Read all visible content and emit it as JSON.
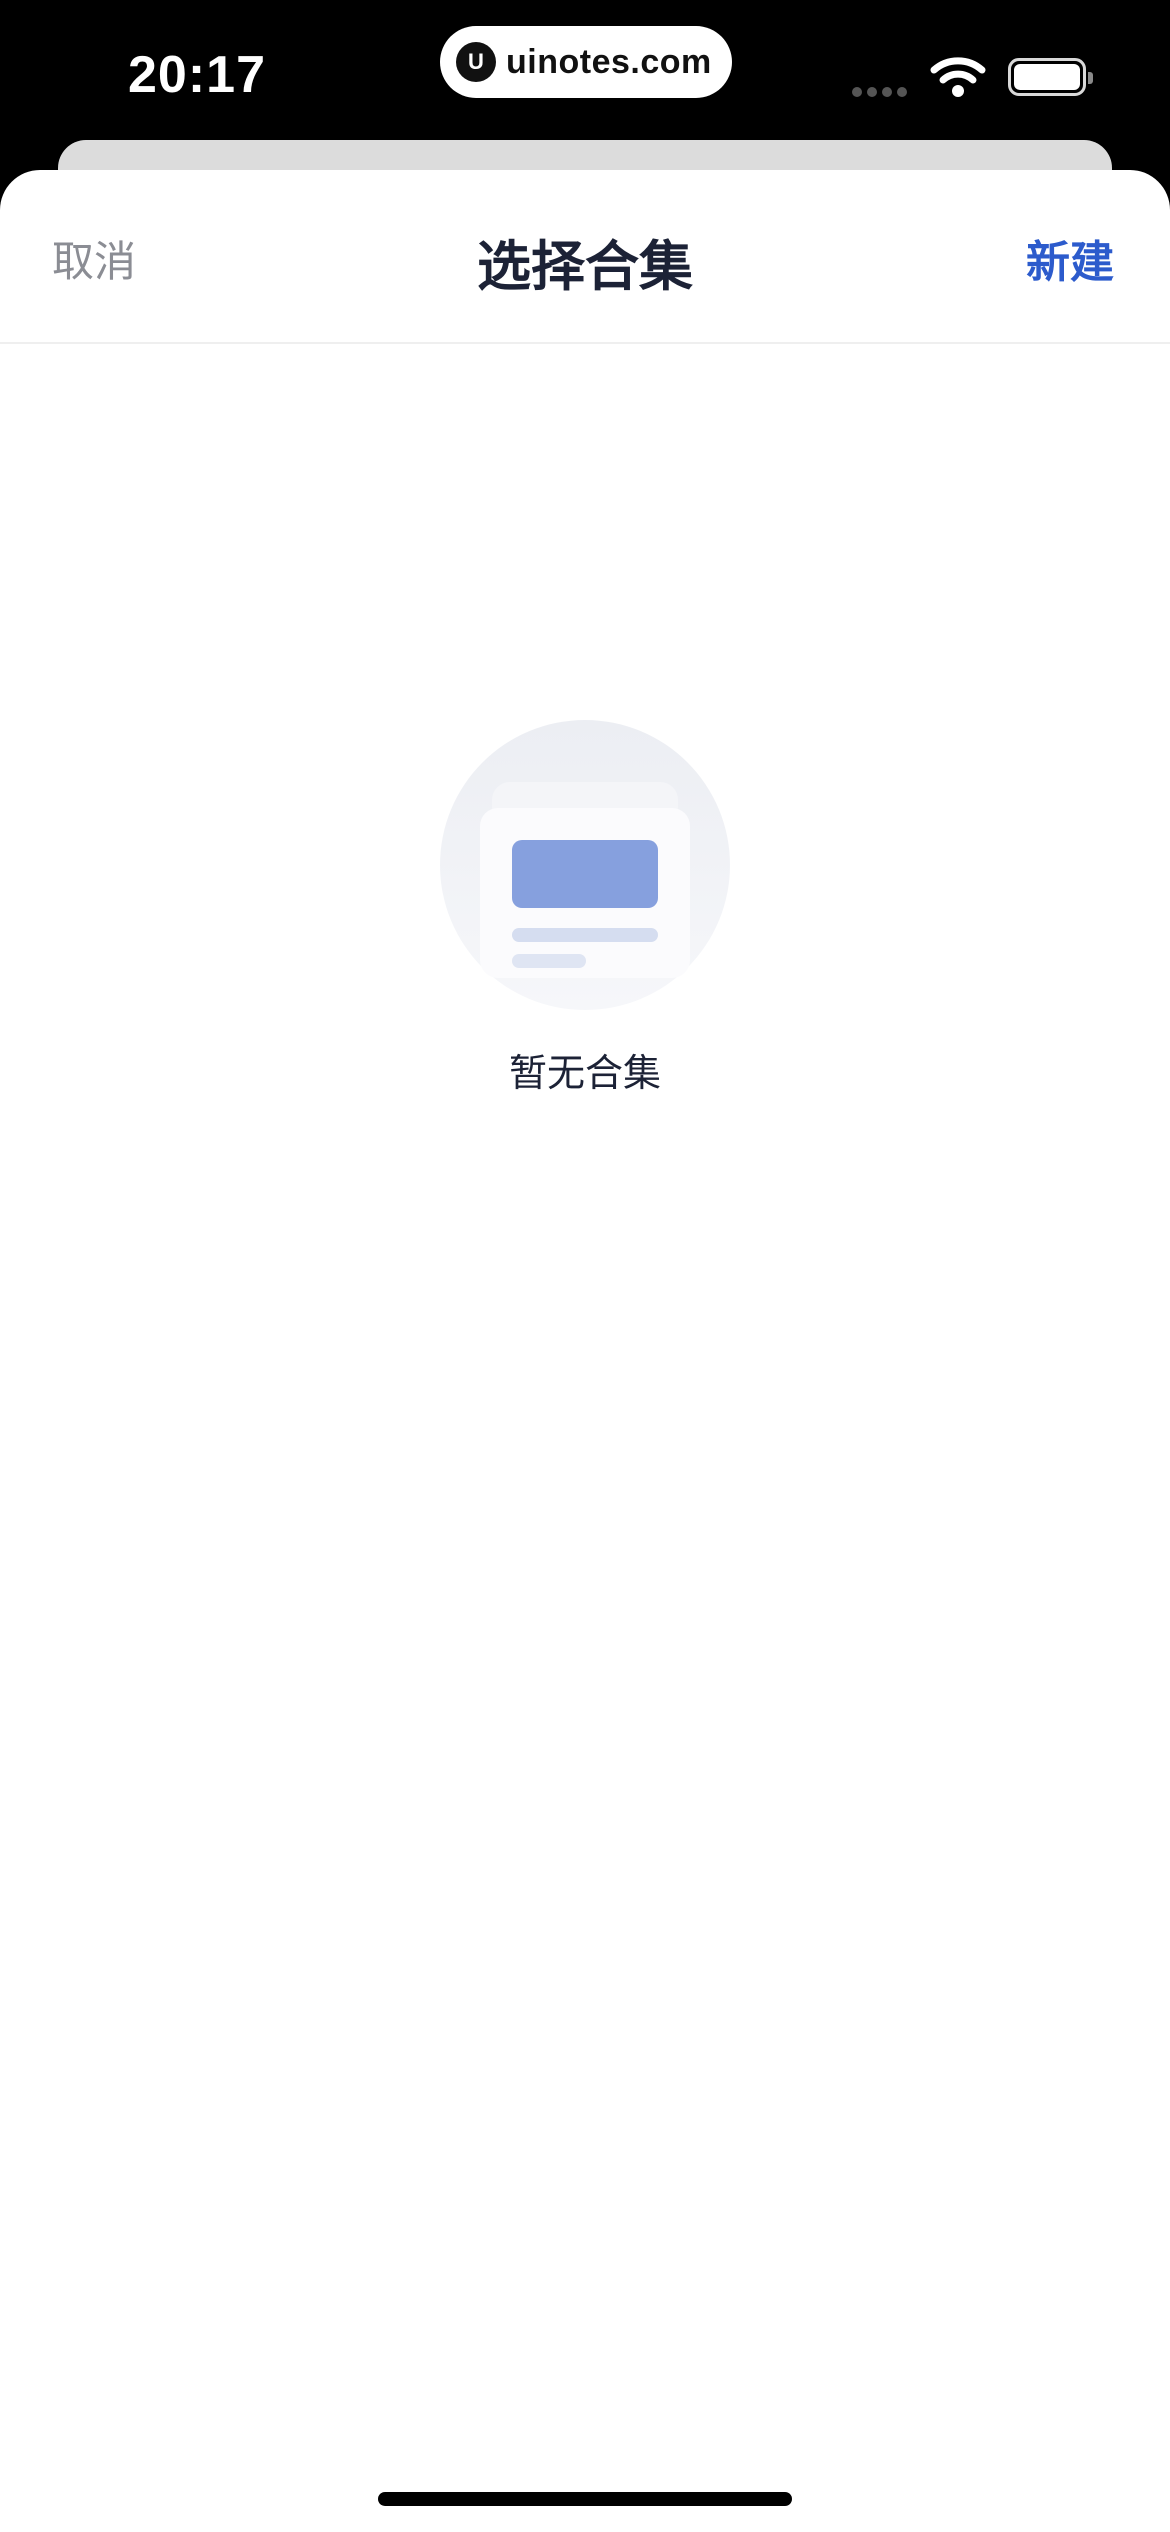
{
  "status_bar": {
    "time": "20:17",
    "watermark_url": "uinotes.com",
    "watermark_logo": "U"
  },
  "nav": {
    "cancel_label": "取消",
    "title": "选择合集",
    "new_label": "新建"
  },
  "empty_state": {
    "message": "暂无合集",
    "illustration": "empty-collection-icon"
  },
  "colors": {
    "accent": "#2c5bcc",
    "title": "#1c2236",
    "muted": "#8b8d94",
    "illustration_card": "#86a0de"
  }
}
